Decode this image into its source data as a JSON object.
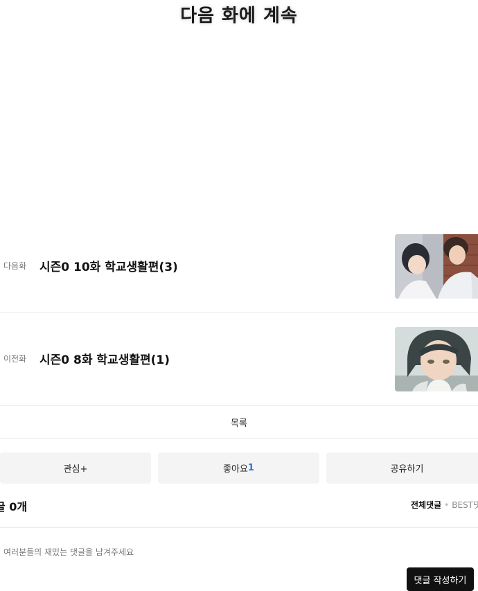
{
  "banner": {
    "text": "다음 화에 계속"
  },
  "episodes": {
    "next": {
      "kind": "다음화",
      "title": "시즌0 10화 학교생활편(3)"
    },
    "prev": {
      "kind": "이전화",
      "title": "시즌0 8화 학교생활편(1)"
    }
  },
  "list_button": {
    "label": "목록"
  },
  "actions": {
    "favorite_label": "관심+",
    "like_label": "좋아요",
    "like_count": "1",
    "share_label": "공유하기"
  },
  "comments": {
    "count_label": "글 0개",
    "sort_all": "전체댓글",
    "sort_best": "BEST댓",
    "placeholder": "여러분들의 재밌는 댓글을 남겨주세요",
    "submit_label": "댓글 작성하기"
  }
}
